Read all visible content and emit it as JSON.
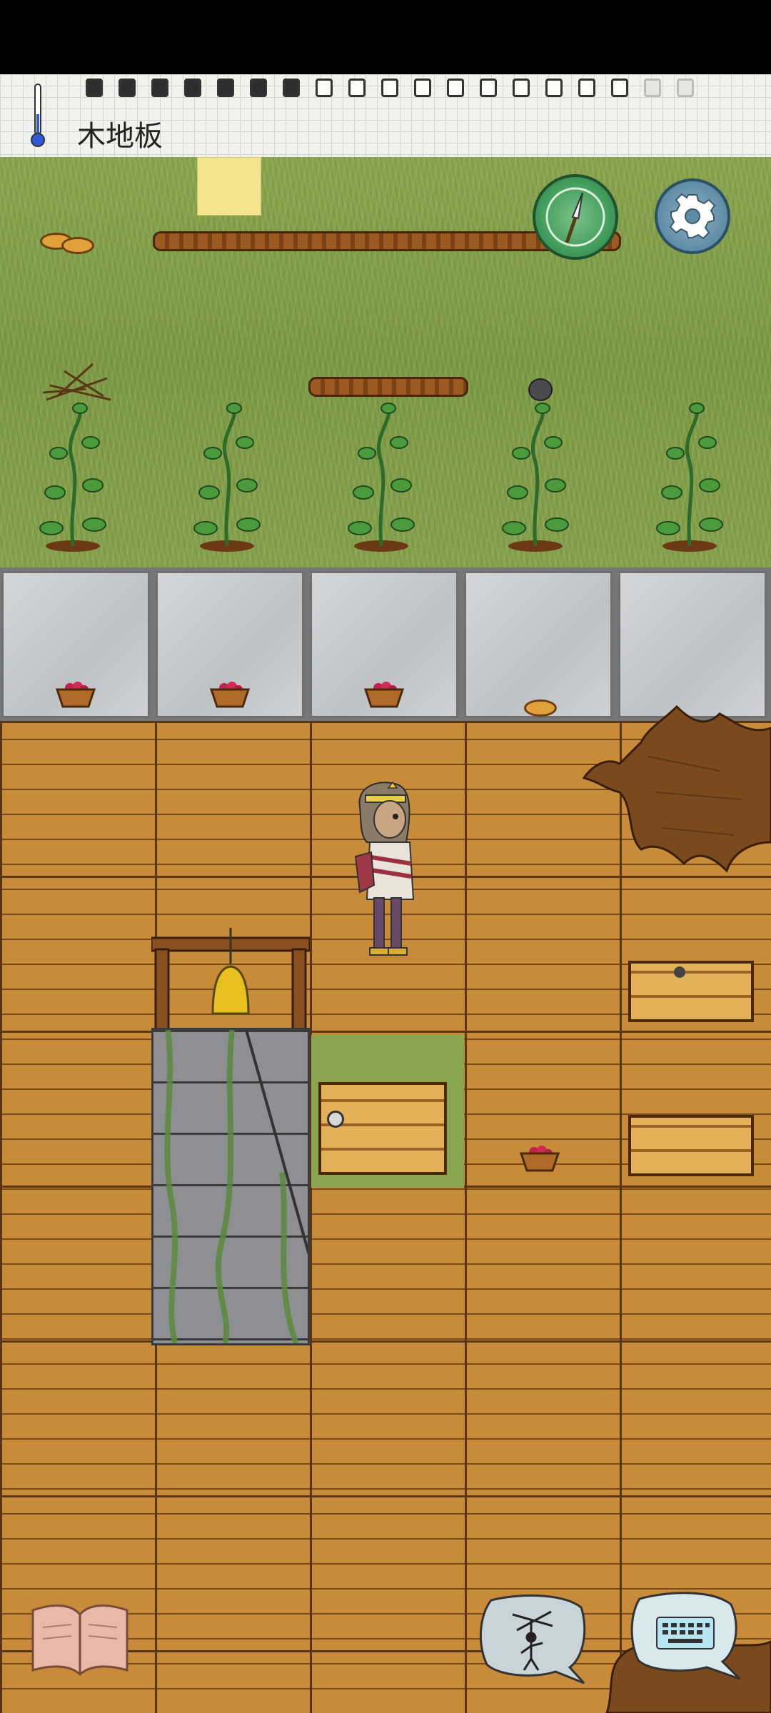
{
  "hud": {
    "location_label": "木地板",
    "food_pips": [
      "full",
      "full",
      "full",
      "full",
      "full",
      "full",
      "full",
      "empty",
      "empty",
      "empty",
      "empty",
      "empty",
      "empty",
      "empty",
      "empty",
      "empty",
      "empty",
      "faint",
      "faint"
    ]
  },
  "icons": {
    "thermometer": "thermometer-icon",
    "compass": "compass-icon",
    "settings": "gear-icon",
    "book": "book-icon",
    "emote": "puppet-emote-icon",
    "keyboard": "keyboard-icon"
  },
  "colors": {
    "compass_green": "#3f9a5a",
    "settings_blue": "#5e8ca6",
    "grass": "#7c9a45",
    "wood_floor": "#c88b3a",
    "stone": "#c8cacc",
    "bell_gold": "#e8c020"
  }
}
